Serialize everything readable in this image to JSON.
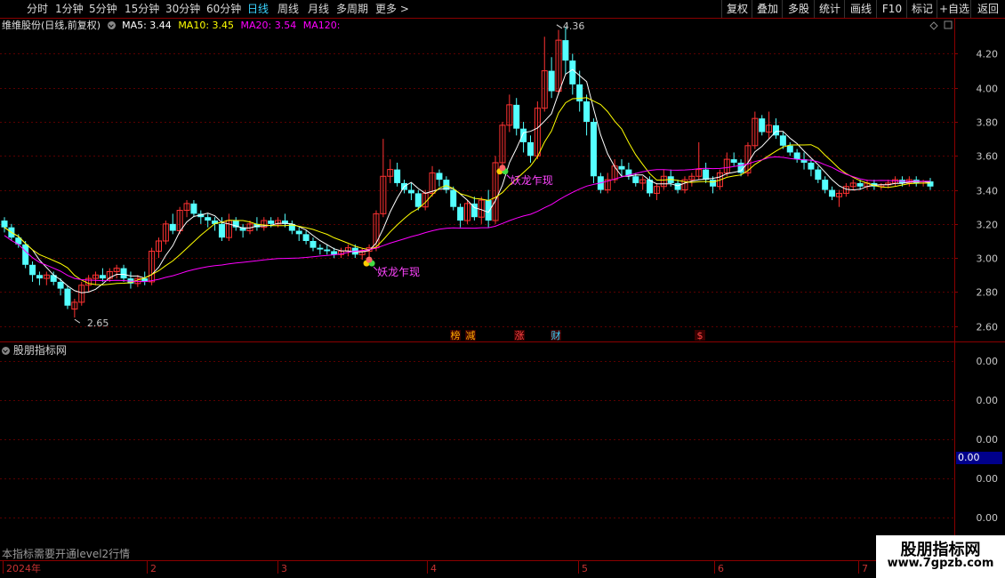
{
  "toolbar": {
    "periods": [
      "分时",
      "1分钟",
      "5分钟",
      "15分钟",
      "30分钟",
      "60分钟",
      "日线",
      "周线",
      "月线",
      "多周期",
      "更多 >"
    ],
    "active": "日线",
    "right_buttons": [
      "复权",
      "叠加",
      "多股",
      "统计",
      "画线",
      "F10",
      "标记",
      "+自选",
      "返回"
    ]
  },
  "legend": {
    "stock": "维维股份(日线,前复权)",
    "ma5": "MA5: 3.44",
    "ma10": "MA10: 3.45",
    "ma20": "MA20: 3.54",
    "ma120": "MA120:",
    "colors": {
      "ma5": "#ffffff",
      "ma10": "#ffff00",
      "ma20": "#ff00ff",
      "ma120": "#00ff00",
      "up": "#ff3232",
      "down": "#54ffff",
      "signal": "#ff44ff"
    }
  },
  "chart_data": {
    "type": "candlestick",
    "ylim": [
      2.52,
      4.38
    ],
    "yticks": [
      "4.20",
      "4.00",
      "3.80",
      "3.60",
      "3.40",
      "3.20",
      "3.00",
      "2.80",
      "2.60"
    ],
    "x_months": [
      "2024年",
      "2",
      "3",
      "4",
      "5",
      "6",
      "7"
    ],
    "high_label": "4.36",
    "low_label": "2.65",
    "signals": [
      "妖龙乍现",
      "妖龙乍现"
    ],
    "event_tags": [
      "榜",
      "减",
      "涨",
      "财",
      "$"
    ],
    "candles": [
      [
        3.22,
        3.24,
        3.15,
        3.18
      ],
      [
        3.18,
        3.2,
        3.1,
        3.12
      ],
      [
        3.12,
        3.14,
        3.06,
        3.08
      ],
      [
        3.08,
        3.1,
        2.94,
        2.96
      ],
      [
        2.96,
        2.98,
        2.86,
        2.9
      ],
      [
        2.9,
        2.92,
        2.84,
        2.88
      ],
      [
        2.88,
        2.92,
        2.84,
        2.9
      ],
      [
        2.9,
        2.92,
        2.84,
        2.86
      ],
      [
        2.86,
        2.88,
        2.78,
        2.82
      ],
      [
        2.82,
        2.84,
        2.7,
        2.72
      ],
      [
        2.7,
        2.76,
        2.65,
        2.74
      ],
      [
        2.74,
        2.86,
        2.72,
        2.84
      ],
      [
        2.84,
        2.9,
        2.8,
        2.88
      ],
      [
        2.88,
        2.92,
        2.84,
        2.9
      ],
      [
        2.9,
        2.94,
        2.86,
        2.88
      ],
      [
        2.88,
        2.94,
        2.86,
        2.92
      ],
      [
        2.92,
        2.96,
        2.88,
        2.94
      ],
      [
        2.94,
        2.96,
        2.86,
        2.88
      ],
      [
        2.88,
        2.92,
        2.82,
        2.85
      ],
      [
        2.85,
        2.9,
        2.83,
        2.88
      ],
      [
        2.88,
        2.92,
        2.84,
        2.86
      ],
      [
        2.86,
        3.06,
        2.84,
        3.04
      ],
      [
        3.04,
        3.12,
        3.0,
        3.1
      ],
      [
        3.1,
        3.22,
        3.08,
        3.2
      ],
      [
        3.2,
        3.26,
        3.14,
        3.16
      ],
      [
        3.16,
        3.3,
        3.14,
        3.28
      ],
      [
        3.28,
        3.34,
        3.24,
        3.32
      ],
      [
        3.32,
        3.34,
        3.24,
        3.26
      ],
      [
        3.26,
        3.28,
        3.2,
        3.24
      ],
      [
        3.24,
        3.26,
        3.18,
        3.22
      ],
      [
        3.22,
        3.24,
        3.16,
        3.2
      ],
      [
        3.2,
        3.24,
        3.1,
        3.12
      ],
      [
        3.12,
        3.26,
        3.1,
        3.22
      ],
      [
        3.22,
        3.24,
        3.16,
        3.18
      ],
      [
        3.18,
        3.2,
        3.12,
        3.16
      ],
      [
        3.16,
        3.22,
        3.14,
        3.2
      ],
      [
        3.2,
        3.24,
        3.16,
        3.18
      ],
      [
        3.18,
        3.24,
        3.16,
        3.22
      ],
      [
        3.22,
        3.24,
        3.18,
        3.2
      ],
      [
        3.2,
        3.24,
        3.18,
        3.22
      ],
      [
        3.22,
        3.26,
        3.18,
        3.2
      ],
      [
        3.2,
        3.22,
        3.14,
        3.16
      ],
      [
        3.16,
        3.18,
        3.1,
        3.14
      ],
      [
        3.14,
        3.16,
        3.08,
        3.1
      ],
      [
        3.1,
        3.12,
        3.04,
        3.06
      ],
      [
        3.06,
        3.08,
        3.02,
        3.05
      ],
      [
        3.05,
        3.08,
        3.02,
        3.04
      ],
      [
        3.04,
        3.06,
        3.0,
        3.02
      ],
      [
        3.02,
        3.06,
        3.0,
        3.04
      ],
      [
        3.04,
        3.08,
        3.01,
        3.06
      ],
      [
        3.06,
        3.08,
        3.0,
        3.02
      ],
      [
        3.02,
        3.06,
        2.99,
        3.04
      ],
      [
        3.04,
        3.08,
        3.0,
        3.06
      ],
      [
        3.06,
        3.28,
        3.04,
        3.26
      ],
      [
        3.26,
        3.7,
        3.24,
        3.48
      ],
      [
        3.48,
        3.58,
        3.44,
        3.52
      ],
      [
        3.52,
        3.56,
        3.42,
        3.44
      ],
      [
        3.44,
        3.46,
        3.38,
        3.4
      ],
      [
        3.4,
        3.44,
        3.34,
        3.38
      ],
      [
        3.38,
        3.4,
        3.28,
        3.3
      ],
      [
        3.3,
        3.4,
        3.28,
        3.38
      ],
      [
        3.38,
        3.54,
        3.36,
        3.5
      ],
      [
        3.5,
        3.52,
        3.42,
        3.46
      ],
      [
        3.46,
        3.48,
        3.38,
        3.4
      ],
      [
        3.4,
        3.42,
        3.28,
        3.3
      ],
      [
        3.3,
        3.32,
        3.18,
        3.22
      ],
      [
        3.22,
        3.34,
        3.2,
        3.32
      ],
      [
        3.32,
        3.36,
        3.22,
        3.24
      ],
      [
        3.24,
        3.36,
        3.2,
        3.34
      ],
      [
        3.34,
        3.4,
        3.18,
        3.22
      ],
      [
        3.22,
        3.6,
        3.2,
        3.56
      ],
      [
        3.56,
        3.8,
        3.54,
        3.78
      ],
      [
        3.78,
        3.96,
        3.74,
        3.9
      ],
      [
        3.9,
        3.94,
        3.72,
        3.76
      ],
      [
        3.76,
        3.8,
        3.62,
        3.68
      ],
      [
        3.68,
        3.72,
        3.56,
        3.6
      ],
      [
        3.6,
        3.92,
        3.58,
        3.88
      ],
      [
        3.88,
        4.3,
        3.86,
        4.1
      ],
      [
        4.1,
        4.18,
        3.94,
        3.98
      ],
      [
        3.98,
        4.34,
        3.96,
        4.28
      ],
      [
        4.28,
        4.36,
        4.08,
        4.16
      ],
      [
        4.16,
        4.2,
        3.96,
        4.02
      ],
      [
        4.02,
        4.1,
        3.86,
        3.92
      ],
      [
        3.92,
        3.96,
        3.72,
        3.8
      ],
      [
        3.8,
        3.82,
        3.44,
        3.48
      ],
      [
        3.48,
        3.5,
        3.38,
        3.4
      ],
      [
        3.4,
        3.5,
        3.38,
        3.46
      ],
      [
        3.46,
        3.58,
        3.44,
        3.54
      ],
      [
        3.54,
        3.58,
        3.48,
        3.52
      ],
      [
        3.52,
        3.56,
        3.46,
        3.48
      ],
      [
        3.48,
        3.5,
        3.42,
        3.44
      ],
      [
        3.44,
        3.48,
        3.4,
        3.46
      ],
      [
        3.46,
        3.48,
        3.36,
        3.38
      ],
      [
        3.38,
        3.44,
        3.34,
        3.42
      ],
      [
        3.42,
        3.52,
        3.4,
        3.48
      ],
      [
        3.48,
        3.52,
        3.42,
        3.44
      ],
      [
        3.44,
        3.46,
        3.38,
        3.4
      ],
      [
        3.4,
        3.48,
        3.38,
        3.46
      ],
      [
        3.46,
        3.5,
        3.42,
        3.48
      ],
      [
        3.48,
        3.68,
        3.46,
        3.52
      ],
      [
        3.52,
        3.56,
        3.44,
        3.46
      ],
      [
        3.46,
        3.48,
        3.38,
        3.42
      ],
      [
        3.42,
        3.52,
        3.4,
        3.5
      ],
      [
        3.5,
        3.62,
        3.48,
        3.58
      ],
      [
        3.58,
        3.62,
        3.54,
        3.56
      ],
      [
        3.56,
        3.58,
        3.48,
        3.5
      ],
      [
        3.5,
        3.68,
        3.48,
        3.66
      ],
      [
        3.66,
        3.86,
        3.64,
        3.82
      ],
      [
        3.82,
        3.84,
        3.72,
        3.74
      ],
      [
        3.74,
        3.86,
        3.7,
        3.78
      ],
      [
        3.78,
        3.82,
        3.7,
        3.72
      ],
      [
        3.72,
        3.74,
        3.64,
        3.66
      ],
      [
        3.66,
        3.68,
        3.6,
        3.62
      ],
      [
        3.62,
        3.64,
        3.56,
        3.58
      ],
      [
        3.58,
        3.62,
        3.52,
        3.56
      ],
      [
        3.56,
        3.58,
        3.48,
        3.52
      ],
      [
        3.52,
        3.54,
        3.44,
        3.46
      ],
      [
        3.46,
        3.48,
        3.38,
        3.4
      ],
      [
        3.4,
        3.42,
        3.34,
        3.36
      ],
      [
        3.36,
        3.4,
        3.3,
        3.38
      ],
      [
        3.38,
        3.44,
        3.36,
        3.42
      ],
      [
        3.42,
        3.46,
        3.4,
        3.44
      ],
      [
        3.44,
        3.46,
        3.4,
        3.42
      ],
      [
        3.42,
        3.46,
        3.4,
        3.44
      ],
      [
        3.44,
        3.46,
        3.4,
        3.42
      ],
      [
        3.42,
        3.44,
        3.4,
        3.43
      ],
      [
        3.43,
        3.46,
        3.41,
        3.44
      ],
      [
        3.44,
        3.48,
        3.42,
        3.46
      ],
      [
        3.46,
        3.48,
        3.42,
        3.44
      ],
      [
        3.44,
        3.48,
        3.42,
        3.46
      ],
      [
        3.46,
        3.48,
        3.42,
        3.44
      ],
      [
        3.44,
        3.46,
        3.42,
        3.45
      ],
      [
        3.45,
        3.47,
        3.4,
        3.42
      ]
    ]
  },
  "sub_panel": {
    "title": "股朋指标网",
    "yticks": [
      "0.00",
      "0.00",
      "0.00",
      "0.00",
      "0.00"
    ],
    "current_value": "0.00"
  },
  "notice": "本指标需要开通level2行情",
  "watermark": {
    "title": "股朋指标网",
    "url": "www.7gpzb.com"
  }
}
